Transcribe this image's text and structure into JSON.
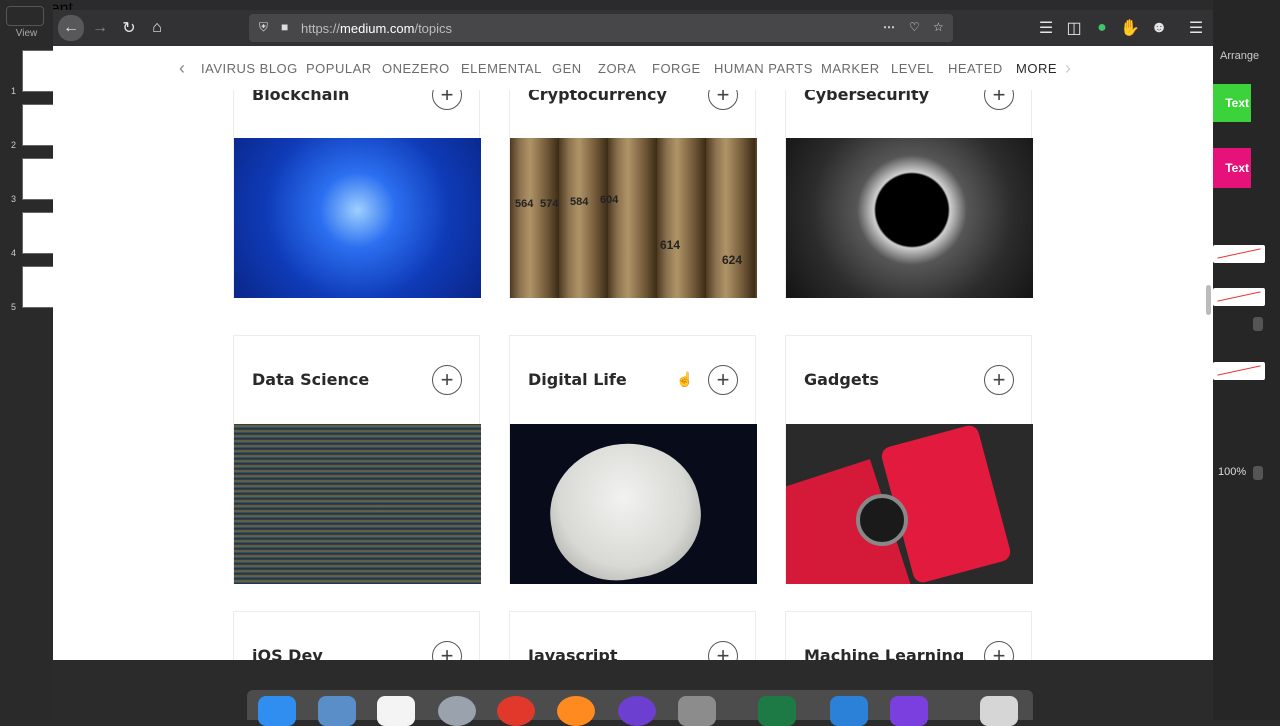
{
  "keynote": {
    "view_label": "View",
    "document_label": "Document",
    "arrange_label": "Arrange",
    "slide_numbers": [
      "1",
      "2",
      "3",
      "4",
      "5"
    ],
    "text_button_green": "Text",
    "text_button_pink": "Text",
    "zoom": "100%"
  },
  "browser": {
    "url_prefix": "https://",
    "url_domain": "medium.com",
    "url_path": "/topics",
    "toolbar_icons": [
      "back-icon",
      "forward-icon",
      "reload-icon",
      "home-icon",
      "shield-icon",
      "lock-icon",
      "more-icon",
      "pocket-icon",
      "star-icon",
      "library-icon",
      "sidebar-icon",
      "grammarly-icon",
      "extension-icon",
      "account-icon",
      "menu-icon"
    ]
  },
  "nav": {
    "items": [
      "IAVIRUS BLOG",
      "POPULAR",
      "ONEZERO",
      "ELEMENTAL",
      "GEN",
      "ZORA",
      "FORGE",
      "HUMAN PARTS",
      "MARKER",
      "LEVEL",
      "HEATED",
      "MORE"
    ]
  },
  "topics": [
    {
      "title": "Blockchain",
      "image": "blockchain-network"
    },
    {
      "title": "Cryptocurrency",
      "image": "deposit-boxes"
    },
    {
      "title": "Cybersecurity",
      "image": "data-tunnel"
    },
    {
      "title": "Data Science",
      "image": "code-screen"
    },
    {
      "title": "Digital Life",
      "image": "mask"
    },
    {
      "title": "Gadgets",
      "image": "red-devices"
    },
    {
      "title": "iOS Dev",
      "image": ""
    },
    {
      "title": "Javascript",
      "image": ""
    },
    {
      "title": "Machine Learning",
      "image": ""
    }
  ],
  "follow_symbol": "+",
  "box_numbers": [
    "564",
    "574",
    "584",
    "604",
    "614",
    "624"
  ]
}
